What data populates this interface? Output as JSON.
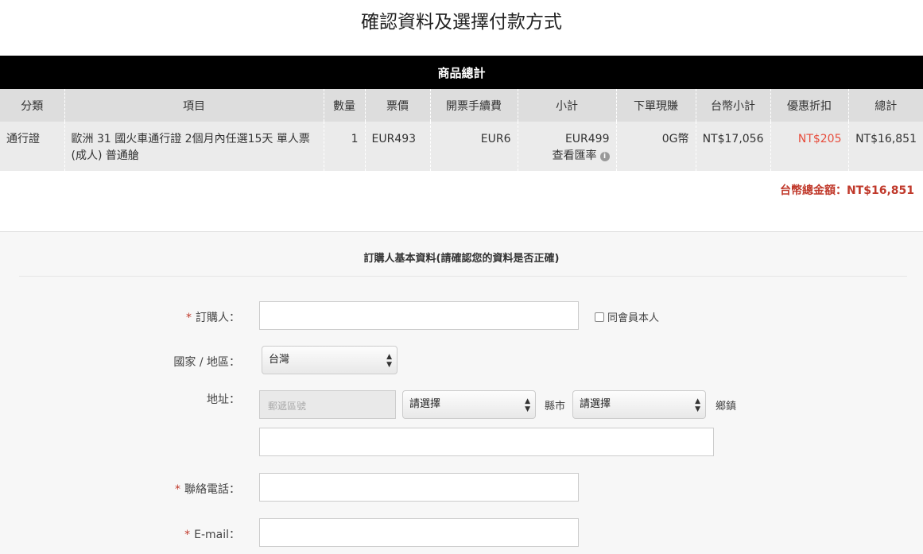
{
  "page_title": "確認資料及選擇付款方式",
  "summary": {
    "header": "商品總計",
    "columns": [
      "分類",
      "項目",
      "數量",
      "票價",
      "開票手續費",
      "小計",
      "下單現賺",
      "台幣小計",
      "優惠折扣",
      "總計"
    ],
    "row": {
      "category": "通行證",
      "item": "歐洲 31 國火車通行證 2個月內任選15天 單人票(成人) 普通艙",
      "qty": "1",
      "price": "EUR493",
      "fee": "EUR6",
      "subtotal": "EUR499",
      "rate_link": "查看匯率",
      "rate_icon": "i",
      "earn": "0G幣",
      "twd_subtotal": "NT$17,056",
      "discount": "NT$205",
      "total": "NT$16,851"
    },
    "grand_total": "台幣總金額：NT$16,851"
  },
  "form": {
    "title": "訂購人基本資料(請確認您的資料是否正確)",
    "required_mark": "*",
    "orderer_label": "訂購人：",
    "same_member_label": "同會員本人",
    "country_label": "國家 / 地區：",
    "country_value": "台灣",
    "address_label": "地址：",
    "zip_placeholder": "郵遞區號",
    "city_value": "請選擇",
    "city_suffix": "縣市",
    "town_value": "請選擇",
    "town_suffix": "鄉鎮",
    "phone_label": "聯絡電話：",
    "email_label": "E-mail："
  },
  "colors": {
    "header_bg": "#000000",
    "discount": "#e74c3c",
    "total": "#c0392b"
  }
}
